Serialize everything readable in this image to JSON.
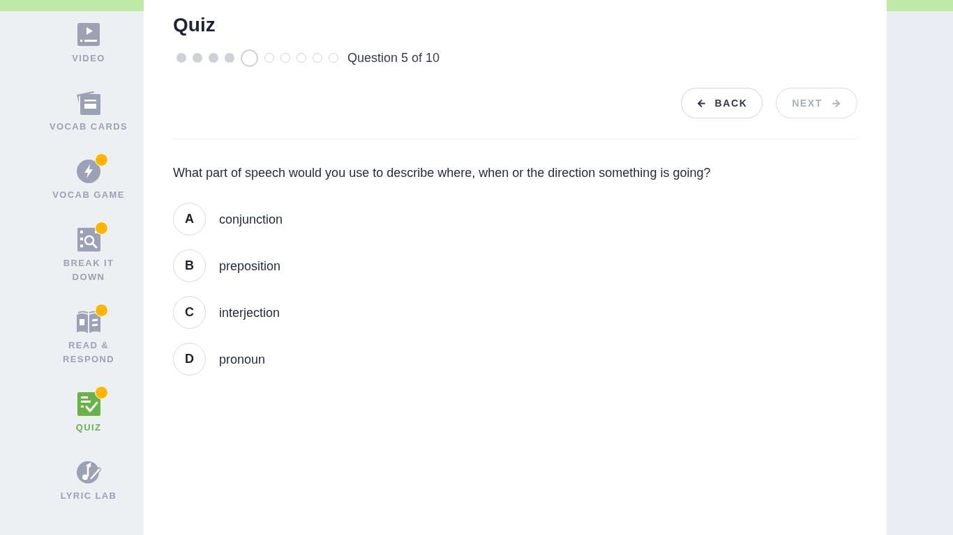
{
  "sidebar": {
    "items": [
      {
        "label": "VIDEO",
        "kind": "video",
        "selected": false,
        "notification": false
      },
      {
        "label": "VOCAB CARDS",
        "kind": "cards",
        "selected": false,
        "notification": false
      },
      {
        "label": "VOCAB GAME",
        "kind": "game",
        "selected": false,
        "notification": true
      },
      {
        "label": "BREAK IT DOWN",
        "kind": "breakdown",
        "selected": false,
        "notification": true
      },
      {
        "label": "READ & RESPOND",
        "kind": "read",
        "selected": false,
        "notification": true
      },
      {
        "label": "QUIZ",
        "kind": "quiz",
        "selected": true,
        "notification": true
      },
      {
        "label": "LYRIC LAB",
        "kind": "lyric",
        "selected": false,
        "notification": false
      }
    ]
  },
  "quiz": {
    "title": "Quiz",
    "progress": [
      {
        "done": true,
        "selected": false
      },
      {
        "done": true,
        "selected": false
      },
      {
        "done": true,
        "selected": false
      },
      {
        "done": true,
        "selected": false
      },
      {
        "done": false,
        "selected": true
      },
      {
        "done": false,
        "selected": false
      },
      {
        "done": false,
        "selected": false
      },
      {
        "done": false,
        "selected": false
      },
      {
        "done": false,
        "selected": false
      },
      {
        "done": false,
        "selected": false
      }
    ],
    "counter": "Question 5 of 10",
    "buttons": [
      {
        "kind": "back",
        "label": "BACK",
        "disabled": false
      },
      {
        "kind": "next",
        "label": "NEXT",
        "disabled": true
      }
    ],
    "question": "What part of speech would you use to describe where, when or the direction something is going?",
    "options": [
      {
        "letter": "A",
        "text": "conjunction",
        "selected": false
      },
      {
        "letter": "B",
        "text": "preposition",
        "selected": false
      },
      {
        "letter": "C",
        "text": "interjection",
        "selected": false
      },
      {
        "letter": "D",
        "text": "pronoun",
        "selected": false
      }
    ]
  }
}
